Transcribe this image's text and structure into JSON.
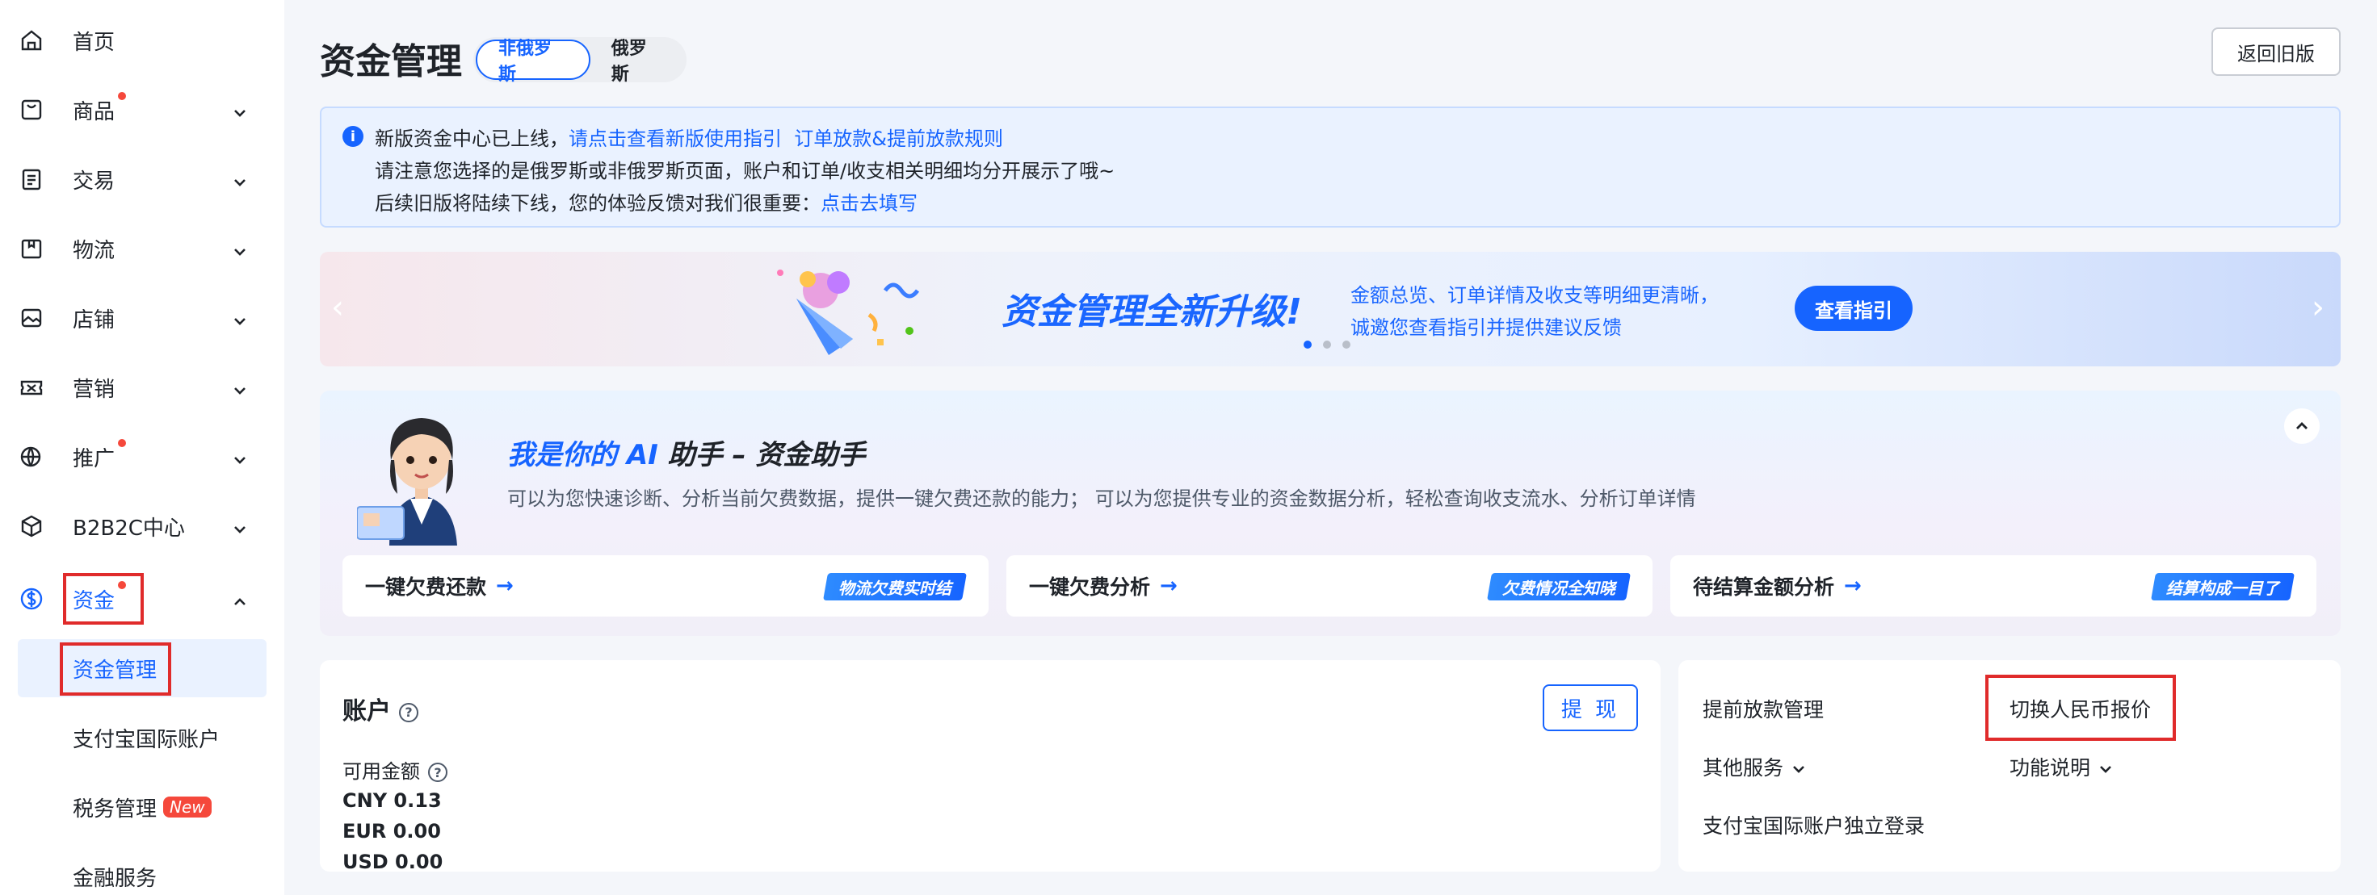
{
  "sidebar": {
    "items": [
      {
        "label": "首页"
      },
      {
        "label": "商品"
      },
      {
        "label": "交易"
      },
      {
        "label": "物流"
      },
      {
        "label": "店铺"
      },
      {
        "label": "营销"
      },
      {
        "label": "推广"
      },
      {
        "label": "B2B2C中心"
      },
      {
        "label": "资金"
      }
    ],
    "sub_items": [
      {
        "label": "资金管理"
      },
      {
        "label": "支付宝国际账户"
      },
      {
        "label": "税务管理",
        "badge": "New"
      },
      {
        "label": "金融服务"
      }
    ]
  },
  "header": {
    "title": "资金管理",
    "tabs": [
      {
        "label": "非俄罗斯"
      },
      {
        "label": "俄罗斯"
      }
    ],
    "back_old": "返回旧版"
  },
  "notice": {
    "icon": "info-icon",
    "line1_text": "新版资金中心已上线，",
    "line1_link1": "请点击查看新版使用指引",
    "line1_link2": "订单放款&提前放款规则",
    "line2_text": "请注意您选择的是俄罗斯或非俄罗斯页面，账户和订单/收支相关明细均分开展示了哦~",
    "line3_text": "后续旧版将陆续下线，您的体验反馈对我们很重要：",
    "line3_link": "点击去填写"
  },
  "banner": {
    "title": "资金管理全新升级!",
    "desc1": "金额总览、订单详情及收支等明细更清晰，",
    "desc2": "诚邀您查看指引并提供建议反馈",
    "button": "查看指引",
    "prev": "‹",
    "next": "›"
  },
  "ai": {
    "title_prefix": "我是你的",
    "title_blue": "AI",
    "title_suffix": "助手 – 资金助手",
    "desc": "可以为您快速诊断、分析当前欠费数据，提供一键欠费还款的能力； 可以为您提供专业的资金数据分析，轻松查询收支流水、分析订单详情",
    "tiles": [
      {
        "label": "一键欠费还款",
        "arrow": "→",
        "tag": "物流欠费实时结"
      },
      {
        "label": "一键欠费分析",
        "arrow": "→",
        "tag": "欠费情况全知晓"
      },
      {
        "label": "待结算金额分析",
        "arrow": "→",
        "tag": "结算构成一目了"
      }
    ]
  },
  "account": {
    "title": "账户",
    "help": "?",
    "withdraw": "提 现",
    "available_label": "可用金额",
    "balances": [
      "CNY 0.13",
      "EUR 0.00",
      "USD 0.00"
    ]
  },
  "services": {
    "early_release": "提前放款管理",
    "switch_cny": "切换人民币报价",
    "other": "其他服务",
    "features": "功能说明",
    "alipay_login": "支付宝国际账户独立登录"
  },
  "colors": {
    "accent": "#1664ff",
    "highlight_box": "#e02b2b",
    "dot": "#f5483b"
  }
}
